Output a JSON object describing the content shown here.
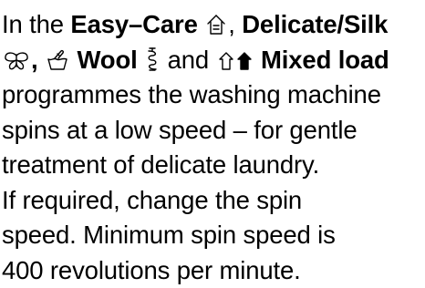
{
  "document": {
    "line1": {
      "t1": "In the ",
      "b1": "Easy–Care",
      "t2": ", ",
      "b2": "Delicate/Silk"
    },
    "line2": {
      "b1": ",",
      "b2": "Wool",
      "t1": " and ",
      "b3": "Mixed load"
    },
    "line3": "programmes the washing machine",
    "line4": "spins at a low speed – for gentle",
    "line5": "treatment of delicate laundry.",
    "line6": "If required, change the spin",
    "line7": "speed. Minimum spin speed is",
    "line8": "400 revolutions per minute."
  },
  "icons": {
    "easy_care": "easy-care-shirt-icon",
    "delicate": "butterfly-icon",
    "silk": "hand-wash-tub-icon",
    "wool": "wool-skein-icon",
    "mixed_load": "mixed-load-shirts-icon"
  }
}
